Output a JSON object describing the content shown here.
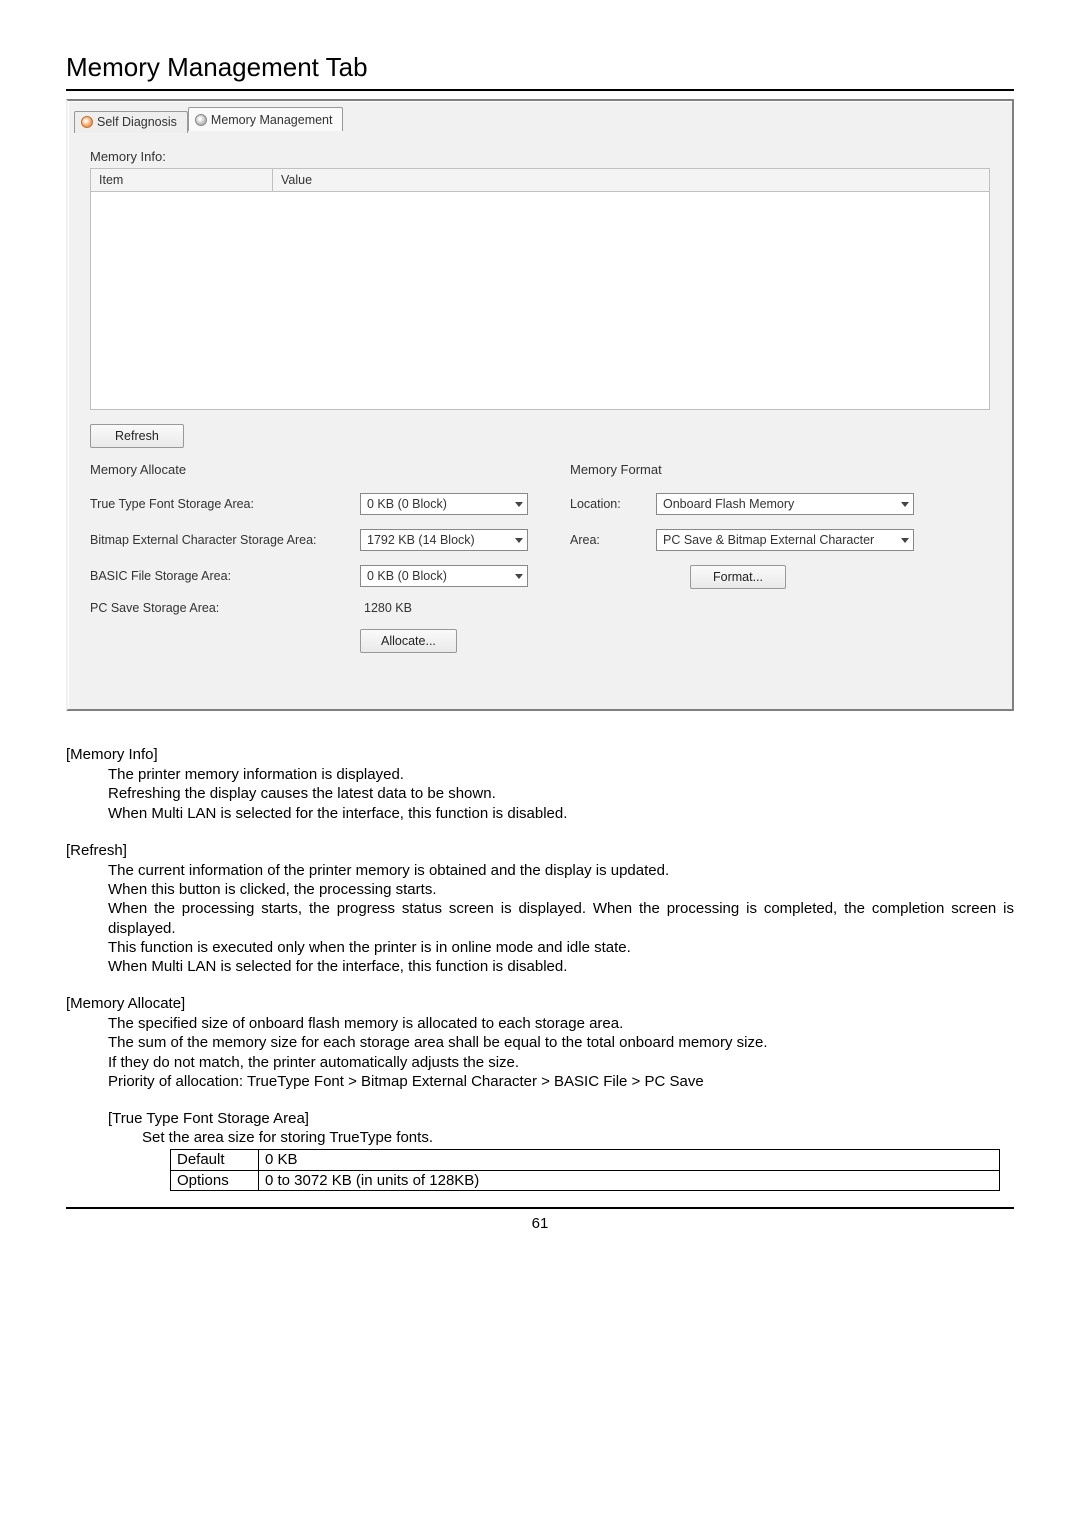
{
  "page": {
    "title": "Memory Management Tab",
    "number": "61"
  },
  "tabs": {
    "self_diagnosis": "Self Diagnosis",
    "memory_management": "Memory Management"
  },
  "memory_info": {
    "label": "Memory Info:",
    "col_item": "Item",
    "col_value": "Value",
    "refresh_btn": "Refresh"
  },
  "memory_allocate": {
    "heading": "Memory Allocate",
    "ttf_label": "True Type Font Storage Area:",
    "ttf_value": "0 KB  (0 Block)",
    "bmp_label": "Bitmap External Character Storage Area:",
    "bmp_value": "1792 KB  (14 Block)",
    "basic_label": "BASIC File Storage Area:",
    "basic_value": "0 KB  (0 Block)",
    "pcsave_label": "PC Save Storage Area:",
    "pcsave_value": "1280 KB",
    "allocate_btn": "Allocate..."
  },
  "memory_format": {
    "heading": "Memory Format",
    "location_label": "Location:",
    "location_value": "Onboard Flash Memory",
    "area_label": "Area:",
    "area_value": "PC Save & Bitmap External Character",
    "format_btn": "Format..."
  },
  "desc": {
    "mem_info_h": "[Memory Info]",
    "mem_info_1": "The printer memory information is displayed.",
    "mem_info_2": "Refreshing the display causes the latest data to be shown.",
    "mem_info_3": "When Multi LAN is selected for the interface, this function is disabled.",
    "refresh_h": "[Refresh]",
    "refresh_1": "The current information of the printer memory is obtained and the display is updated.",
    "refresh_2": "When this button is clicked, the processing starts.",
    "refresh_3": "When the processing starts, the progress status screen is displayed.   When the processing is completed, the completion screen is displayed.",
    "refresh_4": "This function is executed only when the printer is in online mode and idle state.",
    "refresh_5": "When Multi LAN is selected for the interface, this function is disabled.",
    "alloc_h": "[Memory Allocate]",
    "alloc_1": "The specified size of onboard flash memory is allocated to each storage area.",
    "alloc_2": "The sum of the memory size for each storage area shall be equal to the total onboard memory size.",
    "alloc_3": "If they do not match, the printer automatically adjusts the size.",
    "alloc_4": "Priority of allocation:   TrueType Font > Bitmap External Character > BASIC File > PC Save",
    "ttf_h": "[True Type Font Storage Area]",
    "ttf_desc": "Set the area size for storing TrueType fonts."
  },
  "ttf_table": {
    "default_label": "Default",
    "default_value": "0 KB",
    "options_label": "Options",
    "options_value": "0 to 3072 KB (in units of 128KB)"
  }
}
